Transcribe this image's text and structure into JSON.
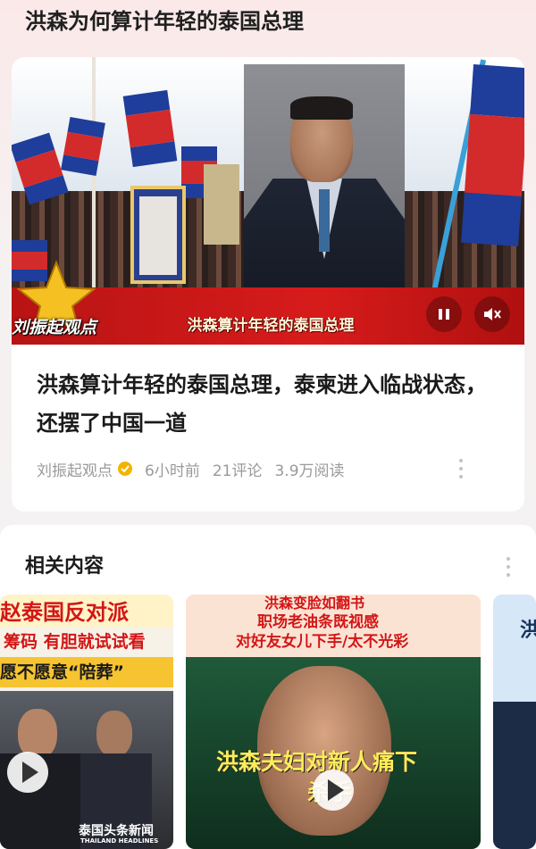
{
  "topic": {
    "title": "洪森为何算计年轻的泰国总理"
  },
  "article": {
    "video": {
      "brand": "刘振起观点",
      "caption": "洪森算计年轻的泰国总理",
      "pause_icon": "pause-icon",
      "mute_icon": "mute-icon"
    },
    "title": "洪森算计年轻的泰国总理，泰柬进入临战状态，还摆了中国一道",
    "author": "刘振起观点",
    "time": "6小时前",
    "comments": "21评论",
    "reads": "3.9万阅读"
  },
  "related": {
    "title": "相关内容",
    "items": [
      {
        "lines": [
          "赵泰国反对派",
          "筹码 有胆就试试看",
          "愿不愿意“陪葬”"
        ],
        "watermark": "泰国头条新闻",
        "watermark_sub": "THAILAND HEADLINES"
      },
      {
        "lines": [
          "洪森变脸如翻书",
          "职场老油条既视感",
          "对好友女儿下手/太不光彩"
        ],
        "caption": "洪森夫妇对新人痛下",
        "caption2": "杀手"
      },
      {
        "lines": [
          "洪"
        ]
      }
    ]
  },
  "colors": {
    "banner_red": "#d71b1b",
    "verified_gold": "#f2b400"
  }
}
